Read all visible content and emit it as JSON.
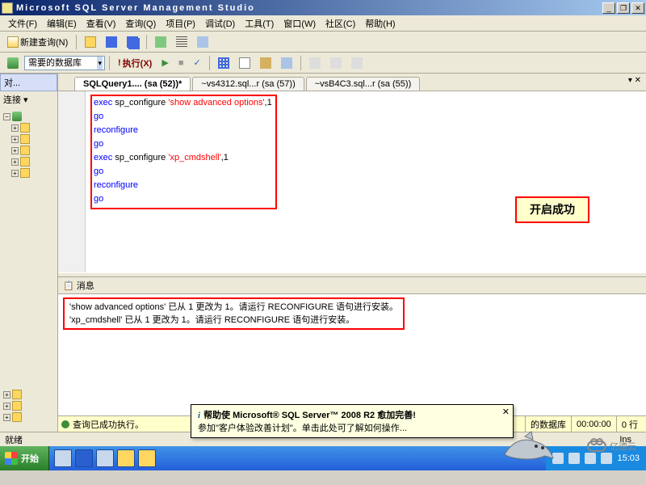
{
  "window": {
    "title": "Microsoft SQL Server Management Studio"
  },
  "menu": {
    "file": "文件(F)",
    "edit": "编辑(E)",
    "view": "查看(V)",
    "query": "查询(Q)",
    "project": "项目(P)",
    "debug": "调试(D)",
    "tool": "工具(T)",
    "window": "窗口(W)",
    "community": "社区(C)",
    "help": "帮助(H)"
  },
  "toolbar1": {
    "newquery": "新建查询(N)"
  },
  "toolbar2": {
    "db": "需要的数据库",
    "exec": "执行(X)"
  },
  "sidebar": {
    "header": "对...",
    "connect": "连接 ▾"
  },
  "tabs": {
    "t1": "SQLQuery1.... (sa (52))*",
    "t2": "~vs4312.sql...r (sa (57))",
    "t3": "~vsB4C3.sql...r (sa (55))"
  },
  "code": {
    "l1a": "exec",
    "l1b": "sp_configure",
    "l1c": "'show advanced options'",
    "l1d": ",1",
    "l2": "go",
    "l3": "reconfigure",
    "l4": "go",
    "l5a": "exec",
    "l5b": "sp_configure",
    "l5c": "'xp_cmdshell'",
    "l5d": ",1",
    "l6": "go",
    "l7": "reconfigure",
    "l8": "go"
  },
  "callout": "开启成功",
  "messages": {
    "tab": "消息",
    "m1": "'show advanced options' 已从 1 更改为 1。请运行 RECONFIGURE 语句进行安装。",
    "m2": "'xp_cmdshell' 已从 1 更改为 1。请运行 RECONFIGURE 语句进行安装。"
  },
  "status": {
    "ok": "查询已成功执行。",
    "db": "的数据库",
    "time": "00:00:00",
    "rows": "0 行"
  },
  "balloon": {
    "title": "帮助使 Microsoft® SQL Server™ 2008 R2 愈加完善!",
    "body": "参加\"客户体验改善计划\"。单击此处可了解如何操作..."
  },
  "status2": {
    "ready": "就绪",
    "ins": "Ins"
  },
  "taskbar": {
    "start": "开始",
    "clock": "15:03"
  },
  "logo": "亿速云"
}
